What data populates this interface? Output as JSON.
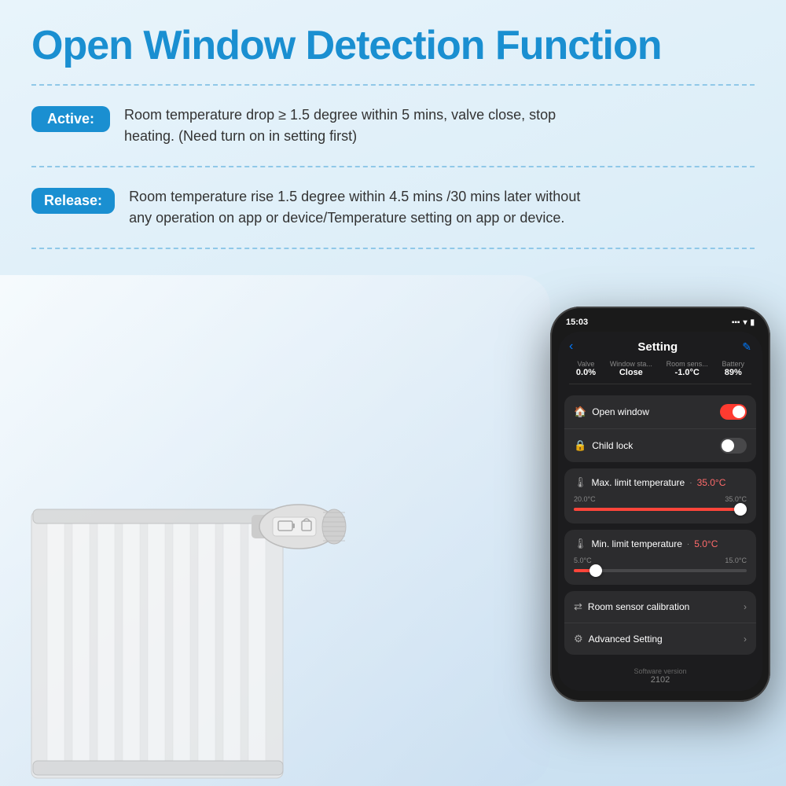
{
  "title": "Open Window Detection Function",
  "active_badge": "Active:",
  "active_text": "Room temperature drop ≥ 1.5 degree within 5 mins, valve close, stop heating. (Need turn on in setting first)",
  "release_badge": "Release:",
  "release_text": "Room temperature rise 1.5 degree within 4.5 mins /30 mins later without any operation on app or device/Temperature setting on app or device.",
  "phone": {
    "time": "15:03",
    "screen_title": "Setting",
    "status_items": [
      {
        "label": "Valve",
        "value": "0.0%"
      },
      {
        "label": "Window sta...",
        "value": "Close"
      },
      {
        "label": "Room sens...",
        "value": "-1.0°C"
      },
      {
        "label": "Battery",
        "value": "89%"
      }
    ],
    "settings": [
      {
        "name": "Open window",
        "type": "toggle-on",
        "icon": "🏠"
      },
      {
        "name": "Child lock",
        "type": "toggle-off",
        "icon": "🔒"
      }
    ],
    "max_temp_label": "Max. limit temperature",
    "max_temp_value": "35.0°C",
    "max_temp_min": "20.0°C",
    "max_temp_max": "35.0°C",
    "min_temp_label": "Min. limit temperature",
    "min_temp_value": "5.0°C",
    "min_temp_range_min": "5.0°C",
    "min_temp_range_max": "15.0°C",
    "room_sensor_label": "Room sensor calibration",
    "advanced_label": "Advanced Setting",
    "version_label": "Software version",
    "version_number": "2102"
  }
}
